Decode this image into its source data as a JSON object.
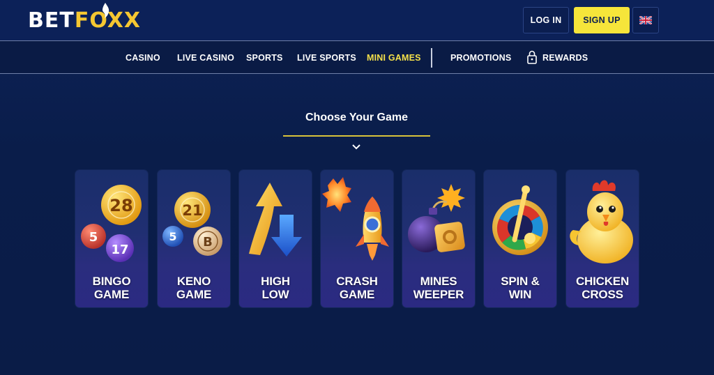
{
  "header": {
    "logo": {
      "part1": "BET",
      "part2": "FOXX"
    },
    "login_label": "LOG IN",
    "signup_label": "SIGN UP",
    "language_icon": "uk-flag-icon"
  },
  "nav": {
    "items": [
      {
        "label": "CASINO",
        "active": false
      },
      {
        "label": "LIVE CASINO",
        "active": false
      },
      {
        "label": "SPORTS",
        "active": false
      },
      {
        "label": "LIVE SPORTS",
        "active": false
      },
      {
        "label": "MINI GAMES",
        "active": true
      },
      {
        "label": "PROMOTIONS",
        "active": false
      },
      {
        "label": "REWARDS",
        "active": false,
        "icon": "lock-icon"
      }
    ]
  },
  "main": {
    "title": "Choose Your Game",
    "games": [
      {
        "line1": "BINGO",
        "line2": "GAME",
        "art": {
          "balls": [
            "28",
            "5",
            "17"
          ]
        }
      },
      {
        "line1": "KENO",
        "line2": "GAME",
        "art": {
          "balls": [
            "21",
            "5",
            "B"
          ]
        }
      },
      {
        "line1": "HIGH",
        "line2": "LOW"
      },
      {
        "line1": "CRASH",
        "line2": "GAME"
      },
      {
        "line1": "MINES",
        "line2": "WEEPER"
      },
      {
        "line1": "SPIN &",
        "line2": "WIN"
      },
      {
        "line1": "CHICKEN",
        "line2": "CROSS"
      }
    ]
  },
  "colors": {
    "background": "#0a1c47",
    "accent_yellow": "#f6e53a",
    "logo_gold": "#f5c731",
    "active_nav": "#f5e04a"
  }
}
